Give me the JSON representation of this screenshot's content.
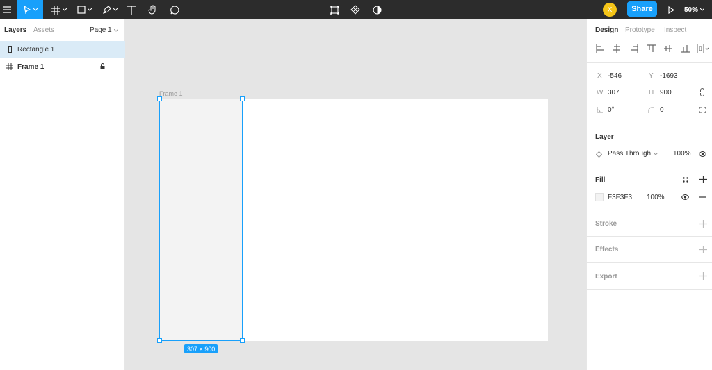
{
  "toolbar": {
    "tools": [
      "menu-icon",
      "move-tool-icon",
      "frame-tool-icon",
      "shape-tool-icon",
      "pen-tool-icon",
      "text-tool-icon",
      "hand-tool-icon",
      "comment-tool-icon"
    ],
    "center_tools": [
      "component-icon",
      "instance-icon",
      "mask-icon"
    ],
    "avatar_initial": "X",
    "share_label": "Share",
    "zoom": "50%",
    "accent": "#18a0fb"
  },
  "left_panel": {
    "tabs": [
      "Layers",
      "Assets"
    ],
    "page": "Page 1",
    "layers": [
      {
        "name": "Rectangle 1",
        "icon": "rectangle-icon",
        "selected": true
      },
      {
        "name": "Frame 1",
        "icon": "frame-icon",
        "locked": true
      }
    ]
  },
  "canvas": {
    "frame_label": "Frame 1",
    "selection_size": "307 × 900",
    "rect_fill": "#f3f3f3"
  },
  "right_panel": {
    "tabs": [
      "Design",
      "Prototype",
      "Inspect"
    ],
    "props": {
      "x_label": "X",
      "x": "-546",
      "y_label": "Y",
      "y": "-1693",
      "w_label": "W",
      "w": "307",
      "h_label": "H",
      "h": "900",
      "rotation": "0°",
      "radius": "0"
    },
    "layer": {
      "title": "Layer",
      "blend": "Pass Through",
      "opacity": "100%"
    },
    "fill": {
      "title": "Fill",
      "hex": "F3F3F3",
      "opacity": "100%"
    },
    "stroke": {
      "title": "Stroke"
    },
    "effects": {
      "title": "Effects"
    },
    "export": {
      "title": "Export"
    }
  }
}
